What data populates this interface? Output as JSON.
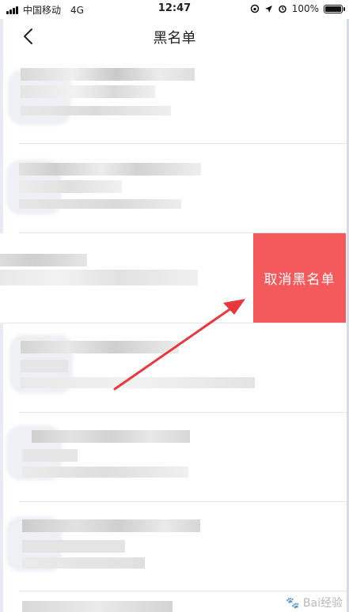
{
  "status_bar": {
    "carrier": "中国移动",
    "network": "4G",
    "time": "12:47",
    "battery_percent": "100%"
  },
  "nav": {
    "title": "黑名单",
    "back_icon": "chevron-left-icon"
  },
  "swipe_action": {
    "label": "取消黑名单",
    "color": "#f4595c"
  },
  "watermark": {
    "brand": "Bai经验",
    "icon": "paw-icon"
  },
  "colors": {
    "accent": "#f4595c",
    "arrow": "#e8383d"
  }
}
